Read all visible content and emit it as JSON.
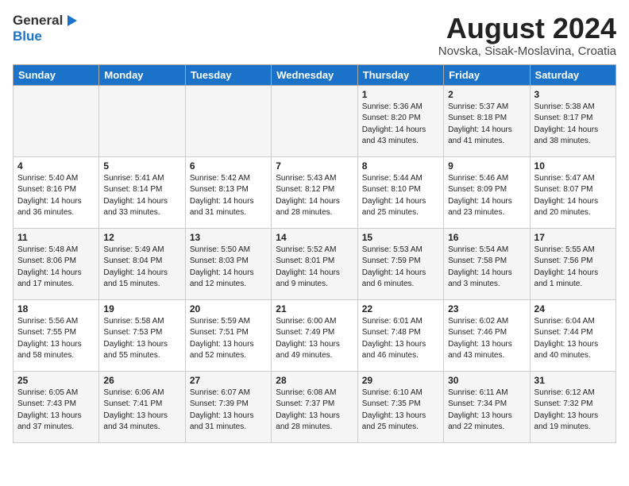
{
  "logo": {
    "general": "General",
    "blue": "Blue"
  },
  "title": "August 2024",
  "subtitle": "Novska, Sisak-Moslavina, Croatia",
  "days_of_week": [
    "Sunday",
    "Monday",
    "Tuesday",
    "Wednesday",
    "Thursday",
    "Friday",
    "Saturday"
  ],
  "weeks": [
    [
      {
        "day": "",
        "info": ""
      },
      {
        "day": "",
        "info": ""
      },
      {
        "day": "",
        "info": ""
      },
      {
        "day": "",
        "info": ""
      },
      {
        "day": "1",
        "info": "Sunrise: 5:36 AM\nSunset: 8:20 PM\nDaylight: 14 hours\nand 43 minutes."
      },
      {
        "day": "2",
        "info": "Sunrise: 5:37 AM\nSunset: 8:18 PM\nDaylight: 14 hours\nand 41 minutes."
      },
      {
        "day": "3",
        "info": "Sunrise: 5:38 AM\nSunset: 8:17 PM\nDaylight: 14 hours\nand 38 minutes."
      }
    ],
    [
      {
        "day": "4",
        "info": "Sunrise: 5:40 AM\nSunset: 8:16 PM\nDaylight: 14 hours\nand 36 minutes."
      },
      {
        "day": "5",
        "info": "Sunrise: 5:41 AM\nSunset: 8:14 PM\nDaylight: 14 hours\nand 33 minutes."
      },
      {
        "day": "6",
        "info": "Sunrise: 5:42 AM\nSunset: 8:13 PM\nDaylight: 14 hours\nand 31 minutes."
      },
      {
        "day": "7",
        "info": "Sunrise: 5:43 AM\nSunset: 8:12 PM\nDaylight: 14 hours\nand 28 minutes."
      },
      {
        "day": "8",
        "info": "Sunrise: 5:44 AM\nSunset: 8:10 PM\nDaylight: 14 hours\nand 25 minutes."
      },
      {
        "day": "9",
        "info": "Sunrise: 5:46 AM\nSunset: 8:09 PM\nDaylight: 14 hours\nand 23 minutes."
      },
      {
        "day": "10",
        "info": "Sunrise: 5:47 AM\nSunset: 8:07 PM\nDaylight: 14 hours\nand 20 minutes."
      }
    ],
    [
      {
        "day": "11",
        "info": "Sunrise: 5:48 AM\nSunset: 8:06 PM\nDaylight: 14 hours\nand 17 minutes."
      },
      {
        "day": "12",
        "info": "Sunrise: 5:49 AM\nSunset: 8:04 PM\nDaylight: 14 hours\nand 15 minutes."
      },
      {
        "day": "13",
        "info": "Sunrise: 5:50 AM\nSunset: 8:03 PM\nDaylight: 14 hours\nand 12 minutes."
      },
      {
        "day": "14",
        "info": "Sunrise: 5:52 AM\nSunset: 8:01 PM\nDaylight: 14 hours\nand 9 minutes."
      },
      {
        "day": "15",
        "info": "Sunrise: 5:53 AM\nSunset: 7:59 PM\nDaylight: 14 hours\nand 6 minutes."
      },
      {
        "day": "16",
        "info": "Sunrise: 5:54 AM\nSunset: 7:58 PM\nDaylight: 14 hours\nand 3 minutes."
      },
      {
        "day": "17",
        "info": "Sunrise: 5:55 AM\nSunset: 7:56 PM\nDaylight: 14 hours\nand 1 minute."
      }
    ],
    [
      {
        "day": "18",
        "info": "Sunrise: 5:56 AM\nSunset: 7:55 PM\nDaylight: 13 hours\nand 58 minutes."
      },
      {
        "day": "19",
        "info": "Sunrise: 5:58 AM\nSunset: 7:53 PM\nDaylight: 13 hours\nand 55 minutes."
      },
      {
        "day": "20",
        "info": "Sunrise: 5:59 AM\nSunset: 7:51 PM\nDaylight: 13 hours\nand 52 minutes."
      },
      {
        "day": "21",
        "info": "Sunrise: 6:00 AM\nSunset: 7:49 PM\nDaylight: 13 hours\nand 49 minutes."
      },
      {
        "day": "22",
        "info": "Sunrise: 6:01 AM\nSunset: 7:48 PM\nDaylight: 13 hours\nand 46 minutes."
      },
      {
        "day": "23",
        "info": "Sunrise: 6:02 AM\nSunset: 7:46 PM\nDaylight: 13 hours\nand 43 minutes."
      },
      {
        "day": "24",
        "info": "Sunrise: 6:04 AM\nSunset: 7:44 PM\nDaylight: 13 hours\nand 40 minutes."
      }
    ],
    [
      {
        "day": "25",
        "info": "Sunrise: 6:05 AM\nSunset: 7:43 PM\nDaylight: 13 hours\nand 37 minutes."
      },
      {
        "day": "26",
        "info": "Sunrise: 6:06 AM\nSunset: 7:41 PM\nDaylight: 13 hours\nand 34 minutes."
      },
      {
        "day": "27",
        "info": "Sunrise: 6:07 AM\nSunset: 7:39 PM\nDaylight: 13 hours\nand 31 minutes."
      },
      {
        "day": "28",
        "info": "Sunrise: 6:08 AM\nSunset: 7:37 PM\nDaylight: 13 hours\nand 28 minutes."
      },
      {
        "day": "29",
        "info": "Sunrise: 6:10 AM\nSunset: 7:35 PM\nDaylight: 13 hours\nand 25 minutes."
      },
      {
        "day": "30",
        "info": "Sunrise: 6:11 AM\nSunset: 7:34 PM\nDaylight: 13 hours\nand 22 minutes."
      },
      {
        "day": "31",
        "info": "Sunrise: 6:12 AM\nSunset: 7:32 PM\nDaylight: 13 hours\nand 19 minutes."
      }
    ]
  ]
}
